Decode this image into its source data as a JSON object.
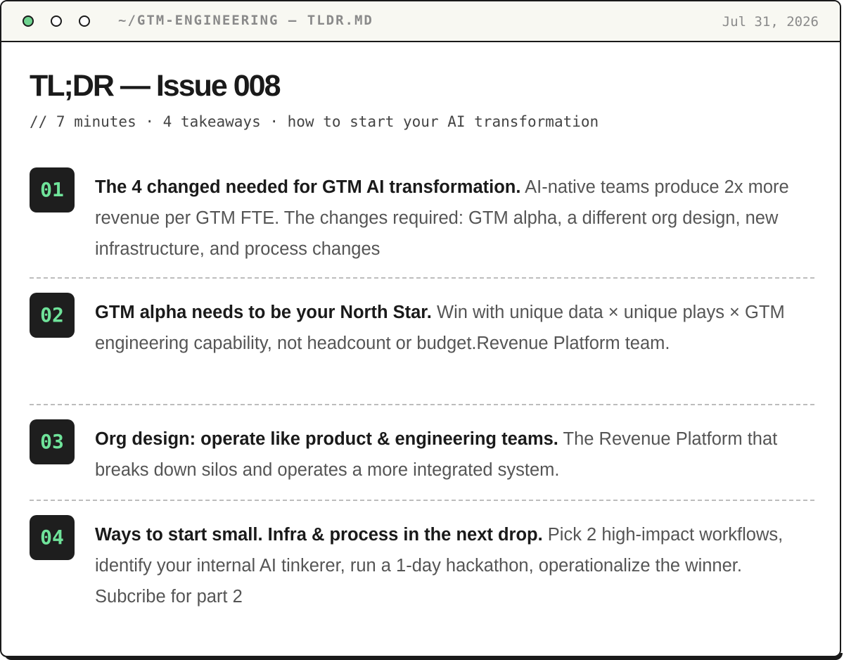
{
  "window": {
    "title": "~/GTM-ENGINEERING — TLDR.MD",
    "date": "Jul 31, 2026"
  },
  "page": {
    "title": "TL;DR — Issue 008",
    "subtitle": "// 7 minutes · 4 takeaways · how to start your AI transformation"
  },
  "items": [
    {
      "number": "01",
      "headline": "The 4 changed needed for GTM AI transformation.",
      "body": "AI-native teams produce 2x more revenue per GTM FTE. The changes required: GTM alpha, a different org design, new infrastructure, and process changes"
    },
    {
      "number": "02",
      "headline": "GTM alpha needs to be your North Star.",
      "body": "Win with unique data × unique plays × GTM engineering capability, not headcount or budget.Revenue Platform team."
    },
    {
      "number": "03",
      "headline": "Org design: operate like product & engineering teams.",
      "body": "The Revenue Platform that breaks down silos and operates a more integrated system."
    },
    {
      "number": "04",
      "headline": "Ways to start small. Infra & process in the next drop.",
      "body": "Pick 2 high-impact workflows, identify your internal AI tinkerer, run a 1-day hackathon, operationalize the winner. Subcribe for part 2"
    }
  ],
  "colors": {
    "accent_green": "#6fe39a",
    "badge_background": "#1e1e1e",
    "titlebar_background": "#f8f8f2"
  }
}
